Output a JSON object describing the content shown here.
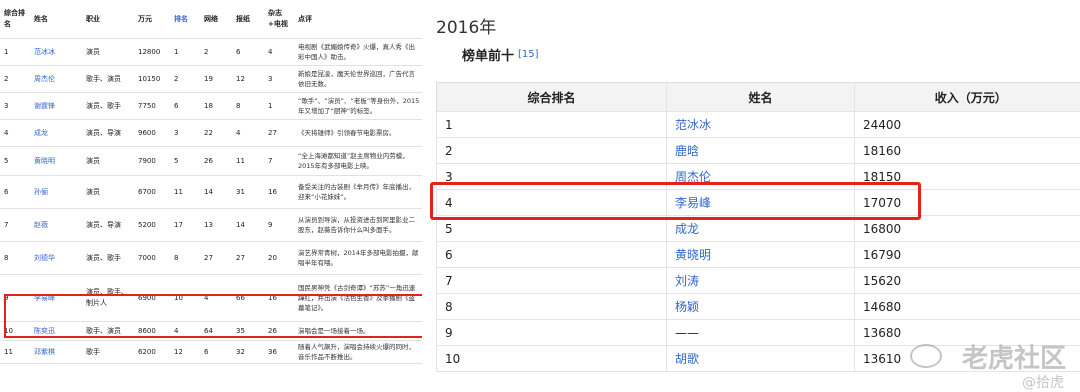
{
  "left": {
    "headers": [
      "综合排名",
      "姓名",
      "职业",
      "万元",
      "排名",
      "网络",
      "报纸",
      "杂志+电视",
      "点评"
    ],
    "rows": [
      {
        "rank": "1",
        "name": "范冰冰",
        "job": "演员",
        "income": "12800",
        "r": "1",
        "net": "2",
        "paper": "6",
        "mag": "4",
        "desc": "电视剧《武媚娘传奇》火爆，真人秀《出彩中国人》助击。"
      },
      {
        "rank": "2",
        "name": "周杰伦",
        "job": "歌手、演员",
        "income": "10150",
        "r": "2",
        "net": "19",
        "paper": "12",
        "mag": "3",
        "desc": "新娘是昆凌，魔天伦世界巡回，广告代言依旧无数。"
      },
      {
        "rank": "3",
        "name": "谢霆锋",
        "job": "演员、歌手",
        "income": "7750",
        "r": "6",
        "net": "18",
        "paper": "8",
        "mag": "1",
        "desc": "“歌手”、“演员”、“老板”等身份外，2015年又增加了“厨神”的标签。"
      },
      {
        "rank": "4",
        "name": "成龙",
        "job": "演员、导演",
        "income": "9600",
        "r": "3",
        "net": "22",
        "paper": "4",
        "mag": "27",
        "desc": "《天将雄师》引领春节电影票房。"
      },
      {
        "rank": "5",
        "name": "黄晓明",
        "job": "演员",
        "income": "7900",
        "r": "5",
        "net": "26",
        "paper": "11",
        "mag": "7",
        "desc": "“全上海滩都知道”赵主席物业内劳模，2015年有多部电影上映。"
      },
      {
        "rank": "6",
        "name": "孙俪",
        "job": "演员",
        "income": "6700",
        "r": "11",
        "net": "14",
        "paper": "31",
        "mag": "16",
        "desc": "备受关注的古装剧《芈月传》年底播出，迎来“小花妹妹”。"
      },
      {
        "rank": "7",
        "name": "赵薇",
        "job": "演员、导演",
        "income": "5200",
        "r": "17",
        "net": "13",
        "paper": "14",
        "mag": "9",
        "desc": "从演员到导演，从投资进击到阿里影业二股东，赵薇告诉你什么叫多面手。"
      },
      {
        "rank": "8",
        "name": "刘德华",
        "job": "演员、歌手",
        "income": "7000",
        "r": "8",
        "net": "27",
        "paper": "27",
        "mag": "20",
        "desc": "演艺界常青树，2014年多部电影拍摄，献唱半年有喂。"
      },
      {
        "rank": "9",
        "name": "李易峰",
        "job": "演员、歌手、制片人",
        "income": "6900",
        "r": "10",
        "net": "4",
        "paper": "66",
        "mag": "16",
        "desc": "国民男神凭《古剑奇谭》“苏苏”一角迅速蹿红，并出演《活色生香》及季播剧《盗墓笔记》。"
      },
      {
        "rank": "10",
        "name": "陈奕迅",
        "job": "歌手、演员",
        "income": "8600",
        "r": "4",
        "net": "64",
        "paper": "35",
        "mag": "26",
        "desc": "演唱会是一场接着一场。"
      },
      {
        "rank": "11",
        "name": "邓紫棋",
        "job": "歌手",
        "income": "6200",
        "r": "12",
        "net": "6",
        "paper": "32",
        "mag": "36",
        "desc": "随着人气飙升，演唱会持续火爆的同时，音乐作品不断推出。"
      }
    ]
  },
  "right": {
    "year": "2016年",
    "subtitle": "榜单前十",
    "cite": "[15]",
    "headers": [
      "综合排名",
      "姓名",
      "收入（万元）"
    ],
    "rows": [
      {
        "rank": "1",
        "name": "范冰冰",
        "income": "24400"
      },
      {
        "rank": "2",
        "name": "鹿晗",
        "income": "18160"
      },
      {
        "rank": "3",
        "name": "周杰伦",
        "income": "18150"
      },
      {
        "rank": "4",
        "name": "李易峰",
        "income": "17070"
      },
      {
        "rank": "5",
        "name": "成龙",
        "income": "16800"
      },
      {
        "rank": "6",
        "name": "黄晓明",
        "income": "16790"
      },
      {
        "rank": "7",
        "name": "刘涛",
        "income": "15620"
      },
      {
        "rank": "8",
        "name": "杨颖",
        "income": "14680"
      },
      {
        "rank": "9",
        "name": "——",
        "income": "13680"
      },
      {
        "rank": "10",
        "name": "胡歌",
        "income": "13610"
      }
    ]
  },
  "watermark": {
    "big": "老虎社区",
    "small": "@拾虎"
  },
  "colors": {
    "highlight": "#e2231a",
    "link": "#3366cc"
  }
}
